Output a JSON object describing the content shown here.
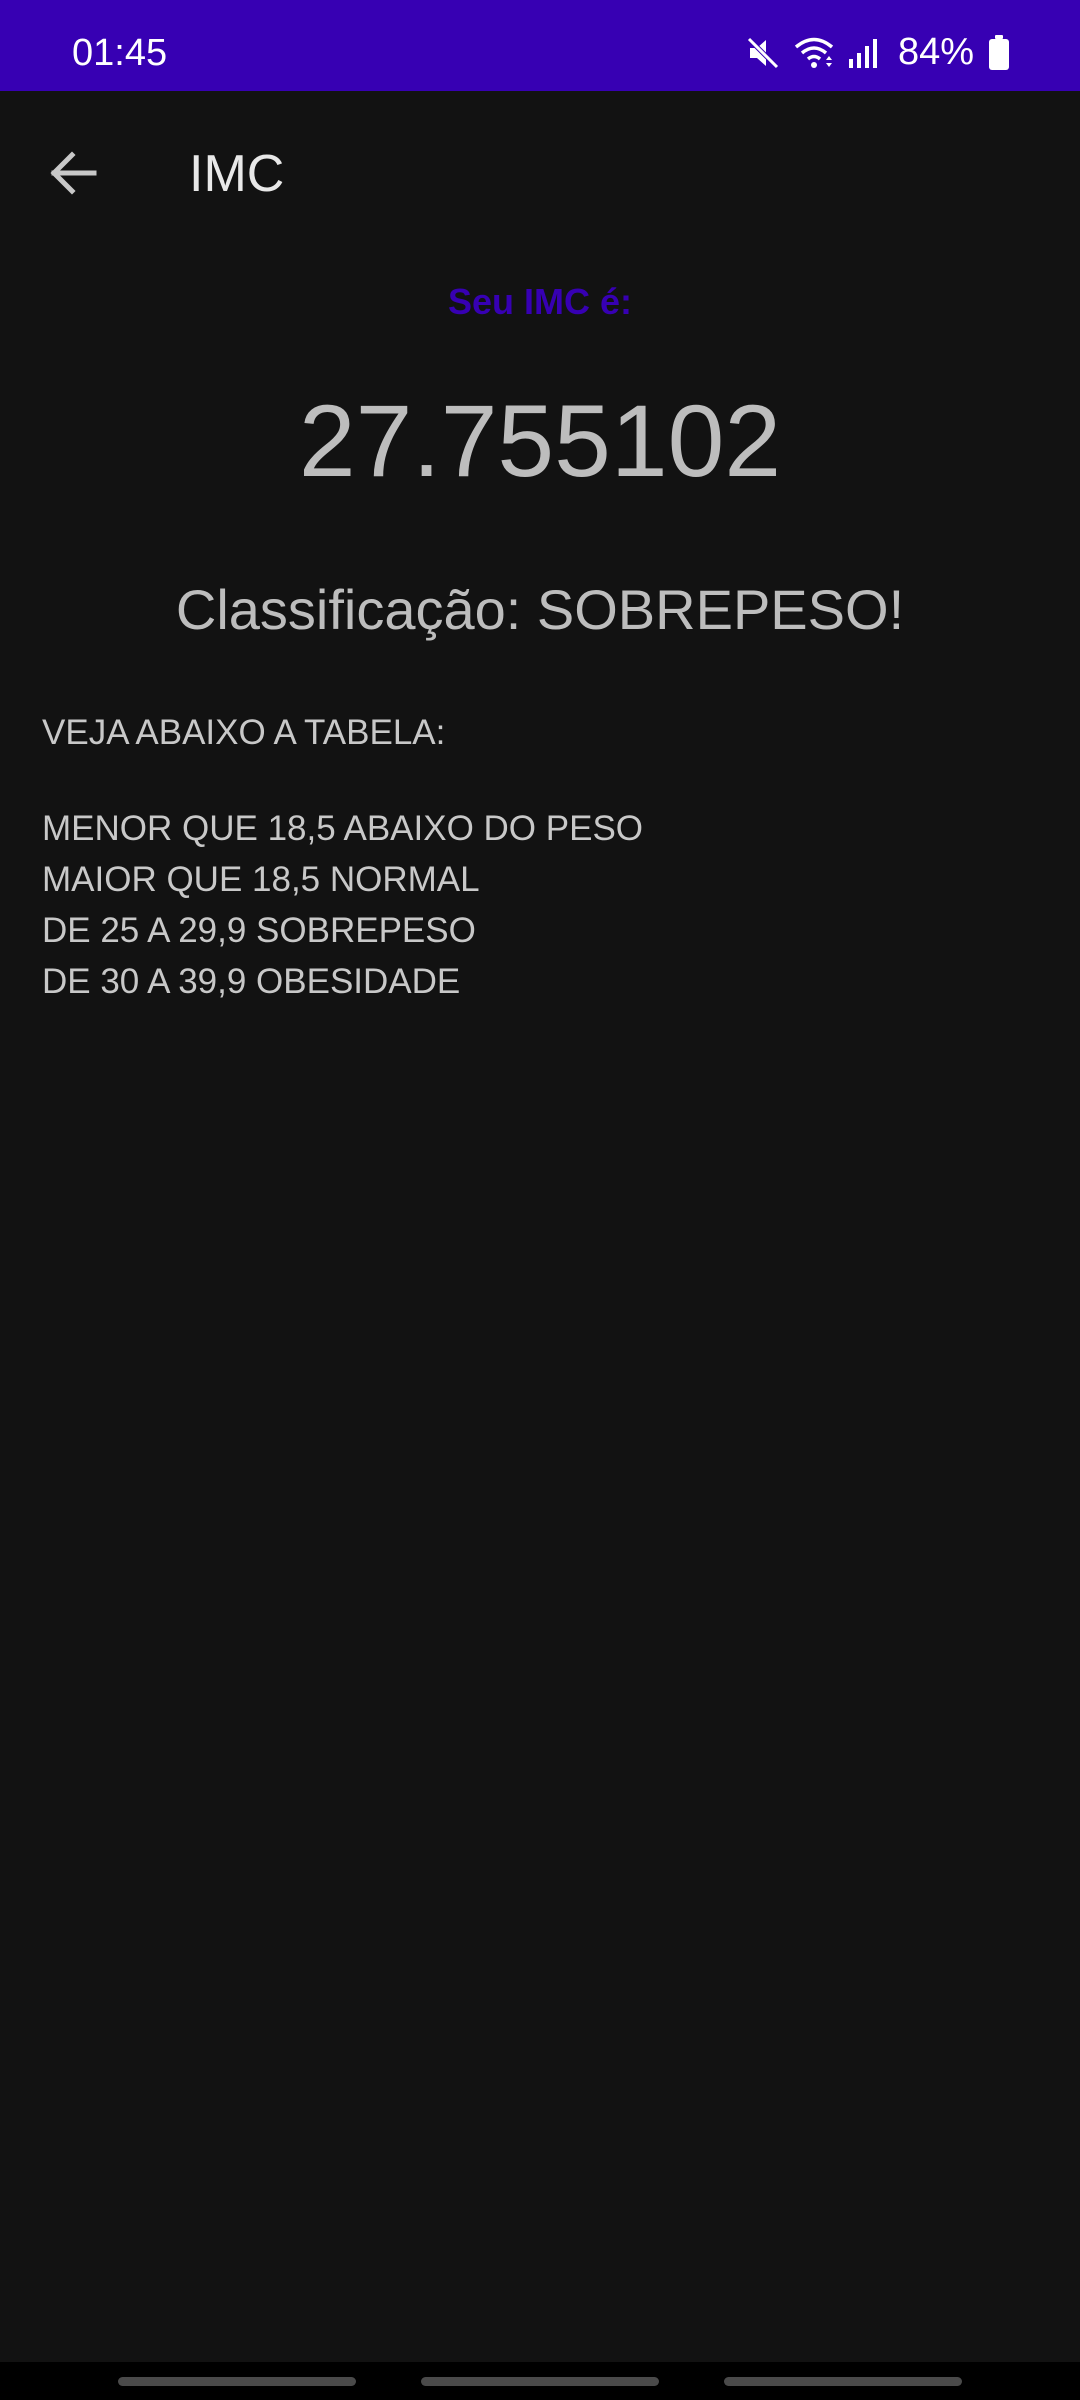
{
  "status_bar": {
    "time": "01:45",
    "battery_percent": "84%",
    "icons": [
      "mute-icon",
      "wifi-icon",
      "signal-icon",
      "battery-icon"
    ],
    "background_color": "#3700b3"
  },
  "toolbar": {
    "title": "IMC",
    "back_icon": "arrow-left-icon"
  },
  "result": {
    "label": "Seu IMC é:",
    "value": "27.755102",
    "classification": "Classificação: SOBREPESO!",
    "label_color": "#3700b3"
  },
  "table": {
    "heading": "VEJA ABAIXO A TABELA:",
    "rows": [
      "MENOR QUE 18,5 ABAIXO DO PESO",
      "MAIOR QUE 18,5 NORMAL",
      "DE 25 A 29,9 SOBREPESO",
      "DE 30 A 39,9 OBESIDADE"
    ]
  }
}
